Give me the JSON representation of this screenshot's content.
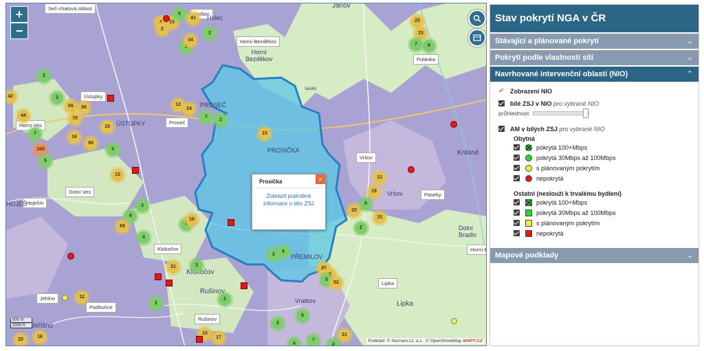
{
  "map": {
    "zoom_in": "+",
    "zoom_out": "−",
    "search_icon": "search-icon",
    "layers_icon": "layers-icon",
    "labels": [
      {
        "id": "sec",
        "text": "Seč-chatová oblast"
      },
      {
        "id": "holsec",
        "text": "Holšec"
      },
      {
        "id": "horni_bezdekov",
        "text": "Horní Bezděkov"
      },
      {
        "id": "polanka",
        "text": "Polánka"
      },
      {
        "id": "ustupky",
        "text": "Ústupky"
      },
      {
        "id": "horni_ves",
        "text": "Horní Ves"
      },
      {
        "id": "prosec",
        "text": "Proseč"
      },
      {
        "id": "dolni_ves",
        "text": "Dolní Ves"
      },
      {
        "id": "hojesin",
        "text": "Hoješín"
      },
      {
        "id": "vrsov",
        "text": "Vršov"
      },
      {
        "id": "paseky",
        "text": "Paseky"
      },
      {
        "id": "klokocov",
        "text": "Klokočov"
      },
      {
        "id": "jehlno",
        "text": "Jehlno"
      },
      {
        "id": "podhorice",
        "text": "Podhořice"
      },
      {
        "id": "rusinov",
        "text": "Rušinov"
      },
      {
        "id": "lipka",
        "text": "Lipka"
      },
      {
        "id": "horni_br",
        "text": "Horní Br"
      }
    ],
    "places": [
      {
        "id": "janov",
        "text": "Janov"
      },
      {
        "id": "horni_bezdekov_p",
        "text": "Horní\nBezděkov"
      },
      {
        "id": "prosec_p",
        "text": "PROSEČ"
      },
      {
        "id": "ustupky_p",
        "text": "ÚSTUPKY"
      },
      {
        "id": "prosicka_p",
        "text": "PROSIČKA"
      },
      {
        "id": "vrsov_p",
        "text": "Vršov"
      },
      {
        "id": "krasne_p",
        "text": "Krásné"
      },
      {
        "id": "klokocov_p",
        "text": "Klokočov"
      },
      {
        "id": "premilov_p",
        "text": "PŘEMILOV"
      },
      {
        "id": "rusinov_p",
        "text": "Rušinov"
      },
      {
        "id": "vratkov_p",
        "text": "Vratkov"
      },
      {
        "id": "lipka_p",
        "text": "Lipka"
      },
      {
        "id": "jehlno_p",
        "text": "Jeřišno"
      },
      {
        "id": "dolni_bradlo_p",
        "text": "Dolní\nBradlo"
      },
      {
        "id": "holec_p",
        "text": "Holec"
      },
      {
        "id": "hoje_p",
        "text": "HOJEŠ"
      },
      {
        "id": "seidlic_p",
        "text": "Seidlic"
      }
    ],
    "clusters": [
      "4",
      "33",
      "5",
      "41",
      "2",
      "2",
      "34",
      "2",
      "25",
      "23",
      "7",
      "6",
      "42",
      "2",
      "3",
      "66",
      "56",
      "44",
      "70",
      "19",
      "7",
      "16",
      "90",
      "3",
      "100",
      "5",
      "15",
      "12",
      "24",
      "7",
      "2",
      "15",
      "13",
      "19",
      "5",
      "20",
      "15",
      "2",
      "3",
      "6",
      "69",
      "4",
      "6",
      "18",
      "2",
      "4",
      "21",
      "3",
      "20",
      "8",
      "5",
      "52",
      "12",
      "2",
      "2",
      "6",
      "2",
      "21",
      "10",
      "17",
      "25",
      "16",
      "4",
      "7",
      "2"
    ],
    "popup": {
      "title": "Prosička",
      "close": "×",
      "link": "Zobrazit podrobné informace o této ZSJ"
    },
    "scale": [
      "500 m",
      "2000 ft"
    ],
    "attribution_prefix": "Podklad: © Seznam.cz, a.s., © OpenStreetMap",
    "attribution_brand": "MAPY.CZ",
    "colors": {
      "nio_fill": "#5bc8e6",
      "nio_border": "#2a7fc0",
      "base_purple": "#a9a3d3",
      "green_area": "#d6ecc4"
    }
  },
  "panel": {
    "title": "Stav pokrytí NGA v ČR",
    "sections": {
      "s1": "Stávající a plánované pokrytí",
      "s2": "Pokrytí podle vlastností sítí",
      "s3": "Navrhované intervenční oblasti (NIO)",
      "s4": "Mapové podklady"
    },
    "zobrazeni": "Zobrazení NIO",
    "bile_zsj_bold": "bílé ZSJ v NIO",
    "bile_zsj_italic": "pro vybrané NIO",
    "pruhlednost": "průhlednost",
    "am_bold": "AM v bílých ZSJ",
    "am_italic": "pro vybrané NIO",
    "obytna": "Obytná",
    "obytna_items": [
      {
        "label": "pokrytá 100+Mbps",
        "color": "#22c02a"
      },
      {
        "label": "pokrytá 30Mbps až 100Mbps",
        "color": "#22d82a"
      },
      {
        "label": "s plánovaným pokrytím",
        "color": "#f2ee2e"
      },
      {
        "label": "nepokrytá",
        "color": "#e01919"
      }
    ],
    "ostatni": "Ostatní (neslouží k trvalému bydlení)",
    "ostatni_items": [
      {
        "label": "pokrytá 100+Mbps",
        "color": "#22c02a"
      },
      {
        "label": "pokrytá 30Mbps až 100Mbps",
        "color": "#22d82a"
      },
      {
        "label": "s plánovaným pokrytím",
        "color": "#f2ee2e"
      },
      {
        "label": "nepokrytá",
        "color": "#e01919"
      }
    ],
    "chevron": "⌄",
    "chevron_up": "⌃"
  }
}
